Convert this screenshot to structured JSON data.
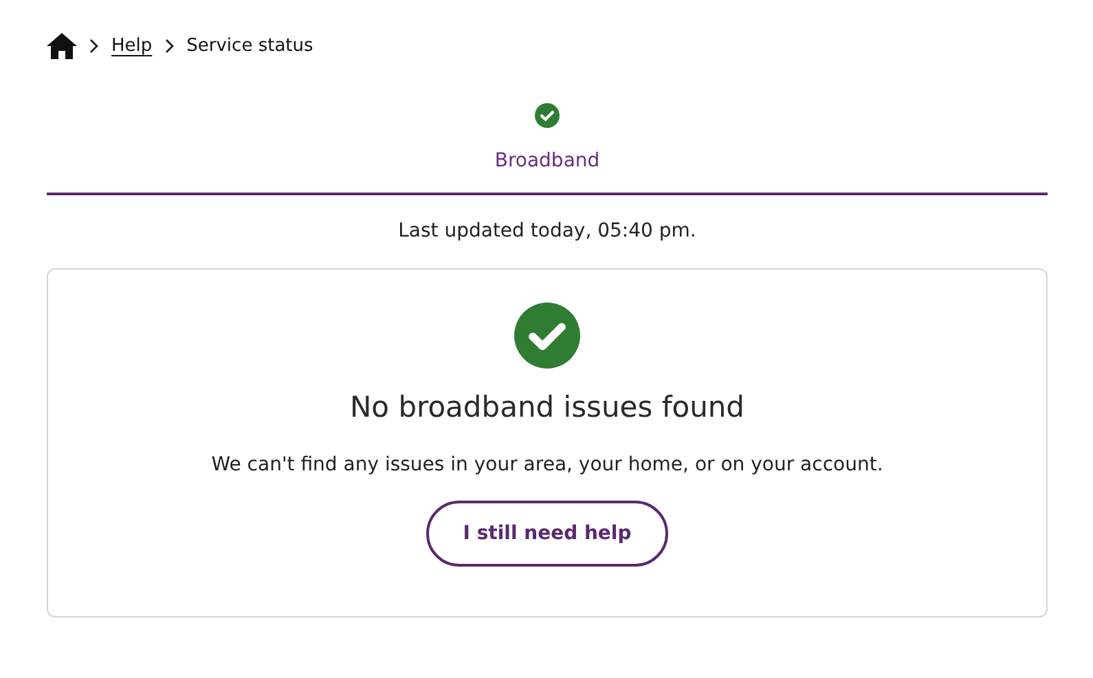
{
  "breadcrumb": {
    "items": [
      {
        "kind": "home"
      },
      {
        "kind": "link",
        "label": "Help"
      },
      {
        "kind": "current",
        "label": "Service status"
      }
    ]
  },
  "tabs": [
    {
      "label": "Broadband",
      "kind": "ok",
      "selected": true
    }
  ],
  "last_updated": "Last updated today, 05:40 pm.",
  "status_card": {
    "kind": "ok",
    "heading": "No broadband issues found",
    "message": "We can't find any issues in your area, your home, or on your account.",
    "button": "I still need help"
  }
}
